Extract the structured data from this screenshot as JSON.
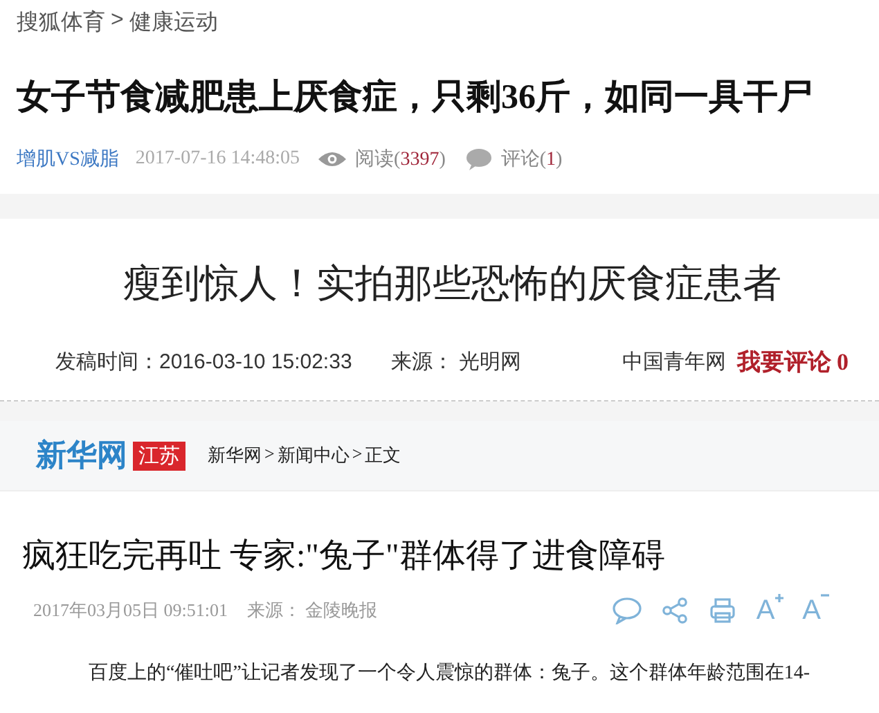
{
  "panels": [
    {
      "kind": "sohu",
      "breadcrumb": [
        {
          "text": "搜狐体育"
        },
        {
          "text": ">"
        },
        {
          "text": "健康运动"
        }
      ],
      "title": "女子节食减肥患上厌食症，只剩36斤，如同一具干尸",
      "tag": "增肌VS减脂",
      "time": "2017-07-16 14:48:05",
      "views_label": "阅读(",
      "views": "3397",
      "views_end": ")",
      "comments_label": "评论(",
      "comments": "1",
      "comments_end": ")"
    },
    {
      "kind": "gmw",
      "title": "瘦到惊人！实拍那些恐怖的厌食症患者",
      "time_label": "发稿时间：",
      "time": "2016-03-10 15:02:33",
      "source_label": "来源：",
      "source": "光明网",
      "site": "中国青年网",
      "comment_link": "我要评论 0"
    },
    {
      "kind": "xinhua",
      "logo": "新华网",
      "logo_badge": "江苏",
      "breadcrumb": [
        {
          "text": "新华网"
        },
        {
          "text": ">"
        },
        {
          "text": "新闻中心"
        },
        {
          "text": ">"
        },
        {
          "text": "正文"
        }
      ],
      "title": "疯狂吃完再吐 专家:\"兔子\"群体得了进食障碍",
      "time": "2017年03月05日 09:51:01",
      "source_label": "来源：",
      "source": "金陵晚报",
      "tools": [
        {
          "kind": "comment"
        },
        {
          "kind": "share"
        },
        {
          "kind": "print"
        },
        {
          "kind": "font-larger",
          "label": "A"
        },
        {
          "kind": "font-smaller",
          "label": "A"
        }
      ],
      "paragraph": "百度上的“催吐吧”让记者发现了一个令人震惊的群体：兔子。这个群体年龄范围在14-"
    }
  ]
}
